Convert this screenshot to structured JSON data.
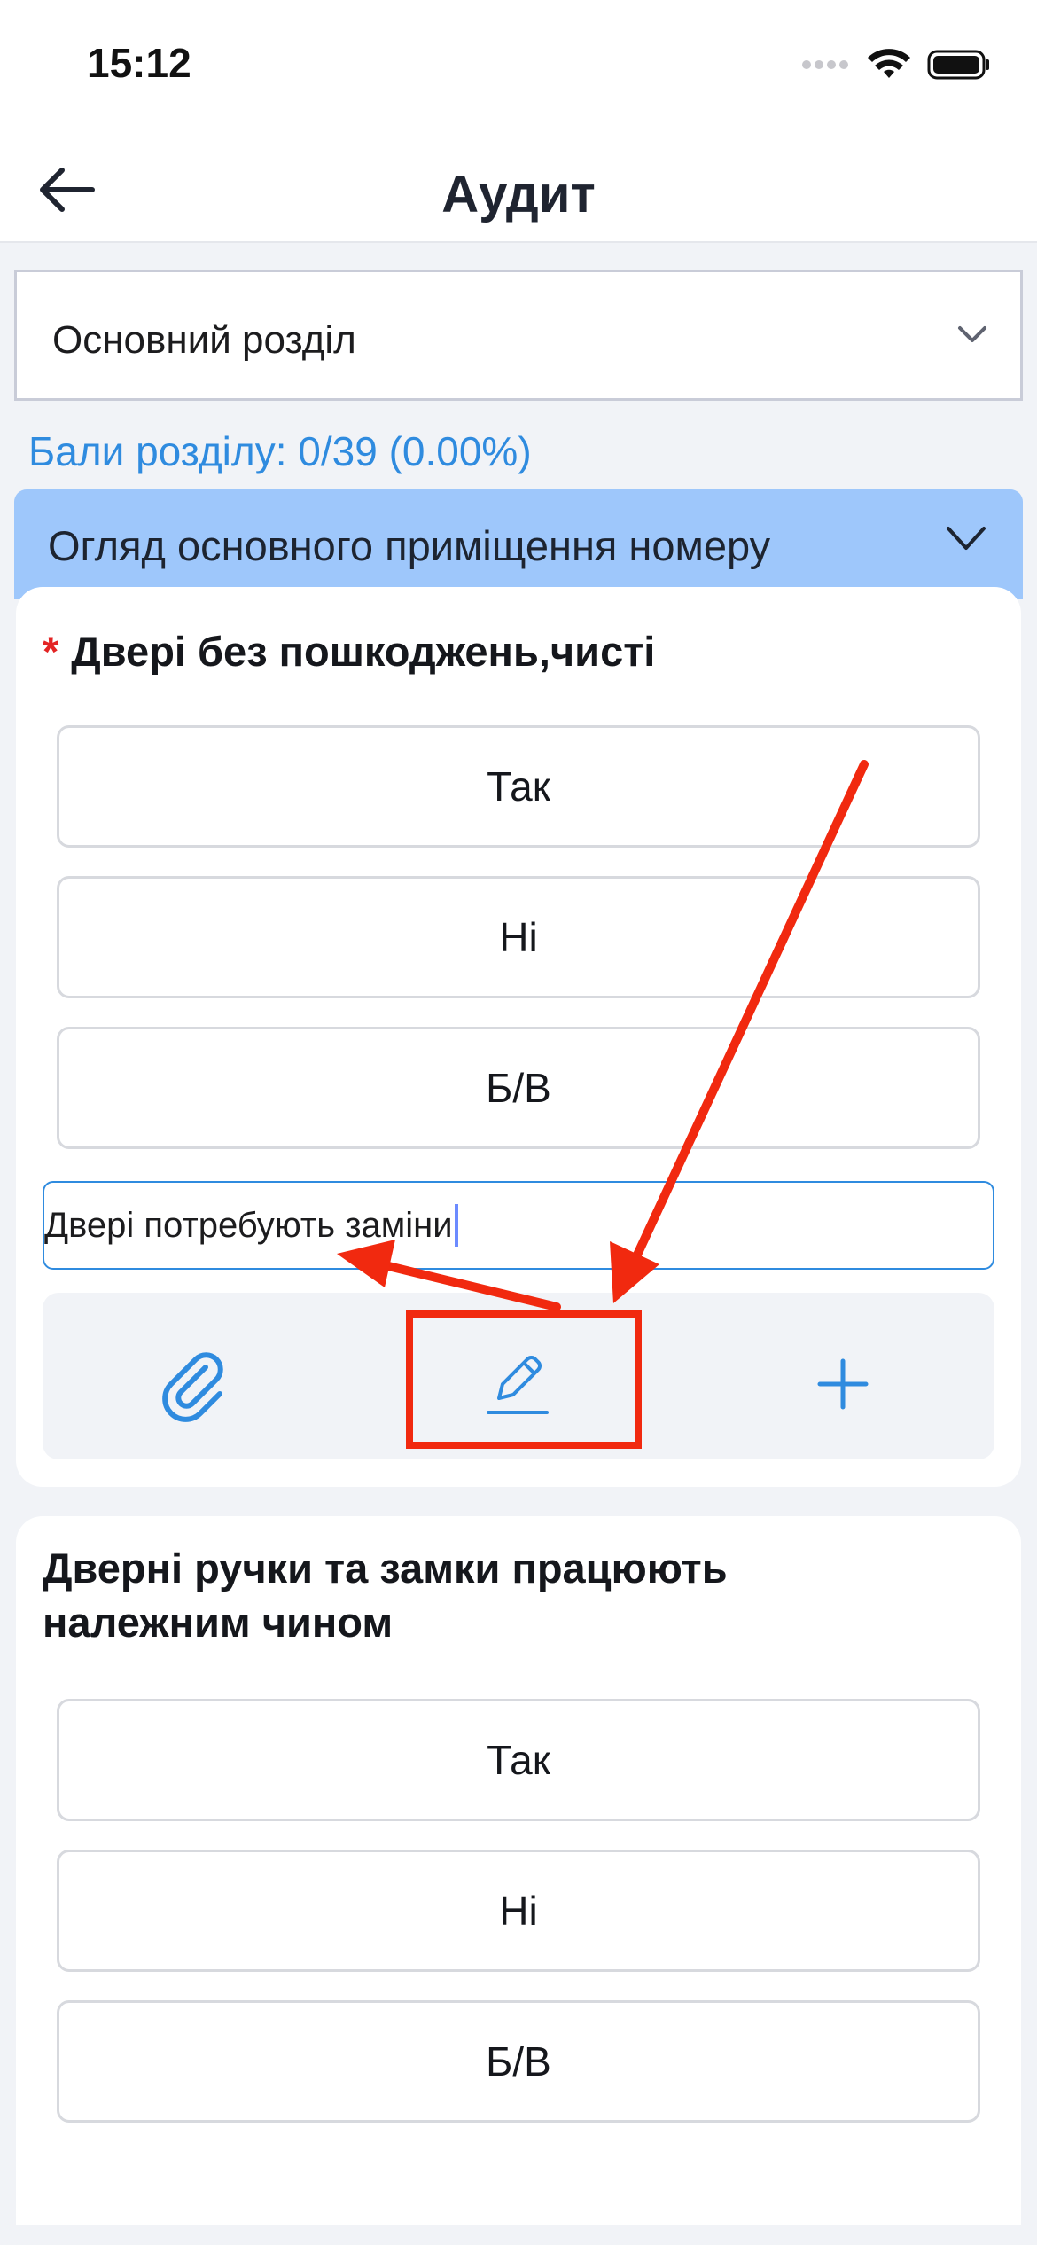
{
  "status_bar": {
    "time": "15:12"
  },
  "nav": {
    "title": "Аудит"
  },
  "section_select": {
    "value": "Основний розділ"
  },
  "score": {
    "text": "Бали розділу: 0/39 (0.00%)"
  },
  "group": {
    "title": "Огляд основного приміщення номеру"
  },
  "questions": [
    {
      "required_mark": "*",
      "title": "Двері без пошкоджень,чисті",
      "options": [
        "Так",
        "Ні",
        "Б/В"
      ],
      "comment": "Двері потребують заміни"
    },
    {
      "title_line1": "Дверні ручки та замки працюють",
      "title_line2": "належним чином",
      "options": [
        "Так",
        "Ні",
        "Б/В"
      ]
    }
  ],
  "colors": {
    "accent": "#2f8bdf",
    "group_header": "#9ec7fb",
    "annotation": "#f1290f",
    "required": "#e32424"
  },
  "icons": {
    "toolbar": [
      "paperclip-icon",
      "pencil-icon",
      "plus-icon"
    ]
  }
}
